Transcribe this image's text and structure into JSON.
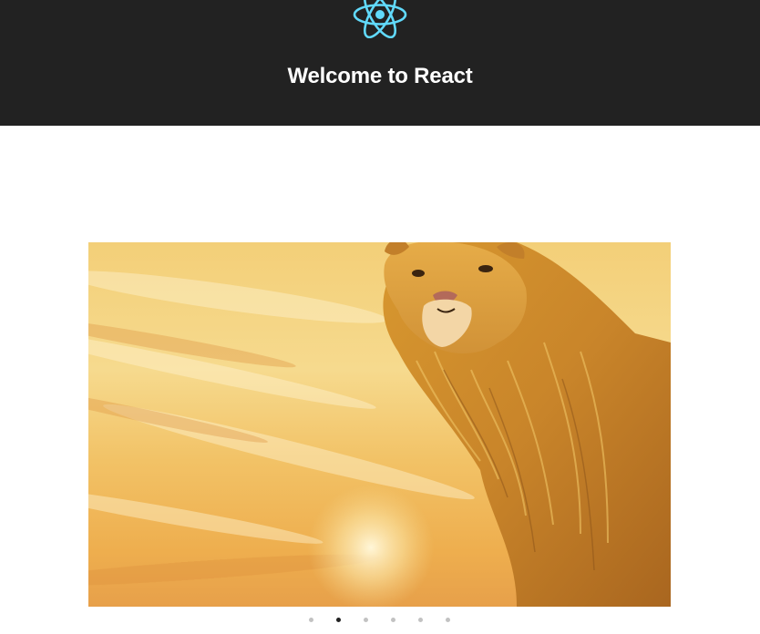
{
  "header": {
    "title": "Welcome to React",
    "logo_icon": "react-logo-icon",
    "logo_color": "#61dafb",
    "background": "#222222"
  },
  "carousel": {
    "slide_count": 6,
    "active_index": 1,
    "current_slide_image": "lion-illustration",
    "dot_active_color": "#222222",
    "dot_inactive_color": "#c2c2c2"
  }
}
